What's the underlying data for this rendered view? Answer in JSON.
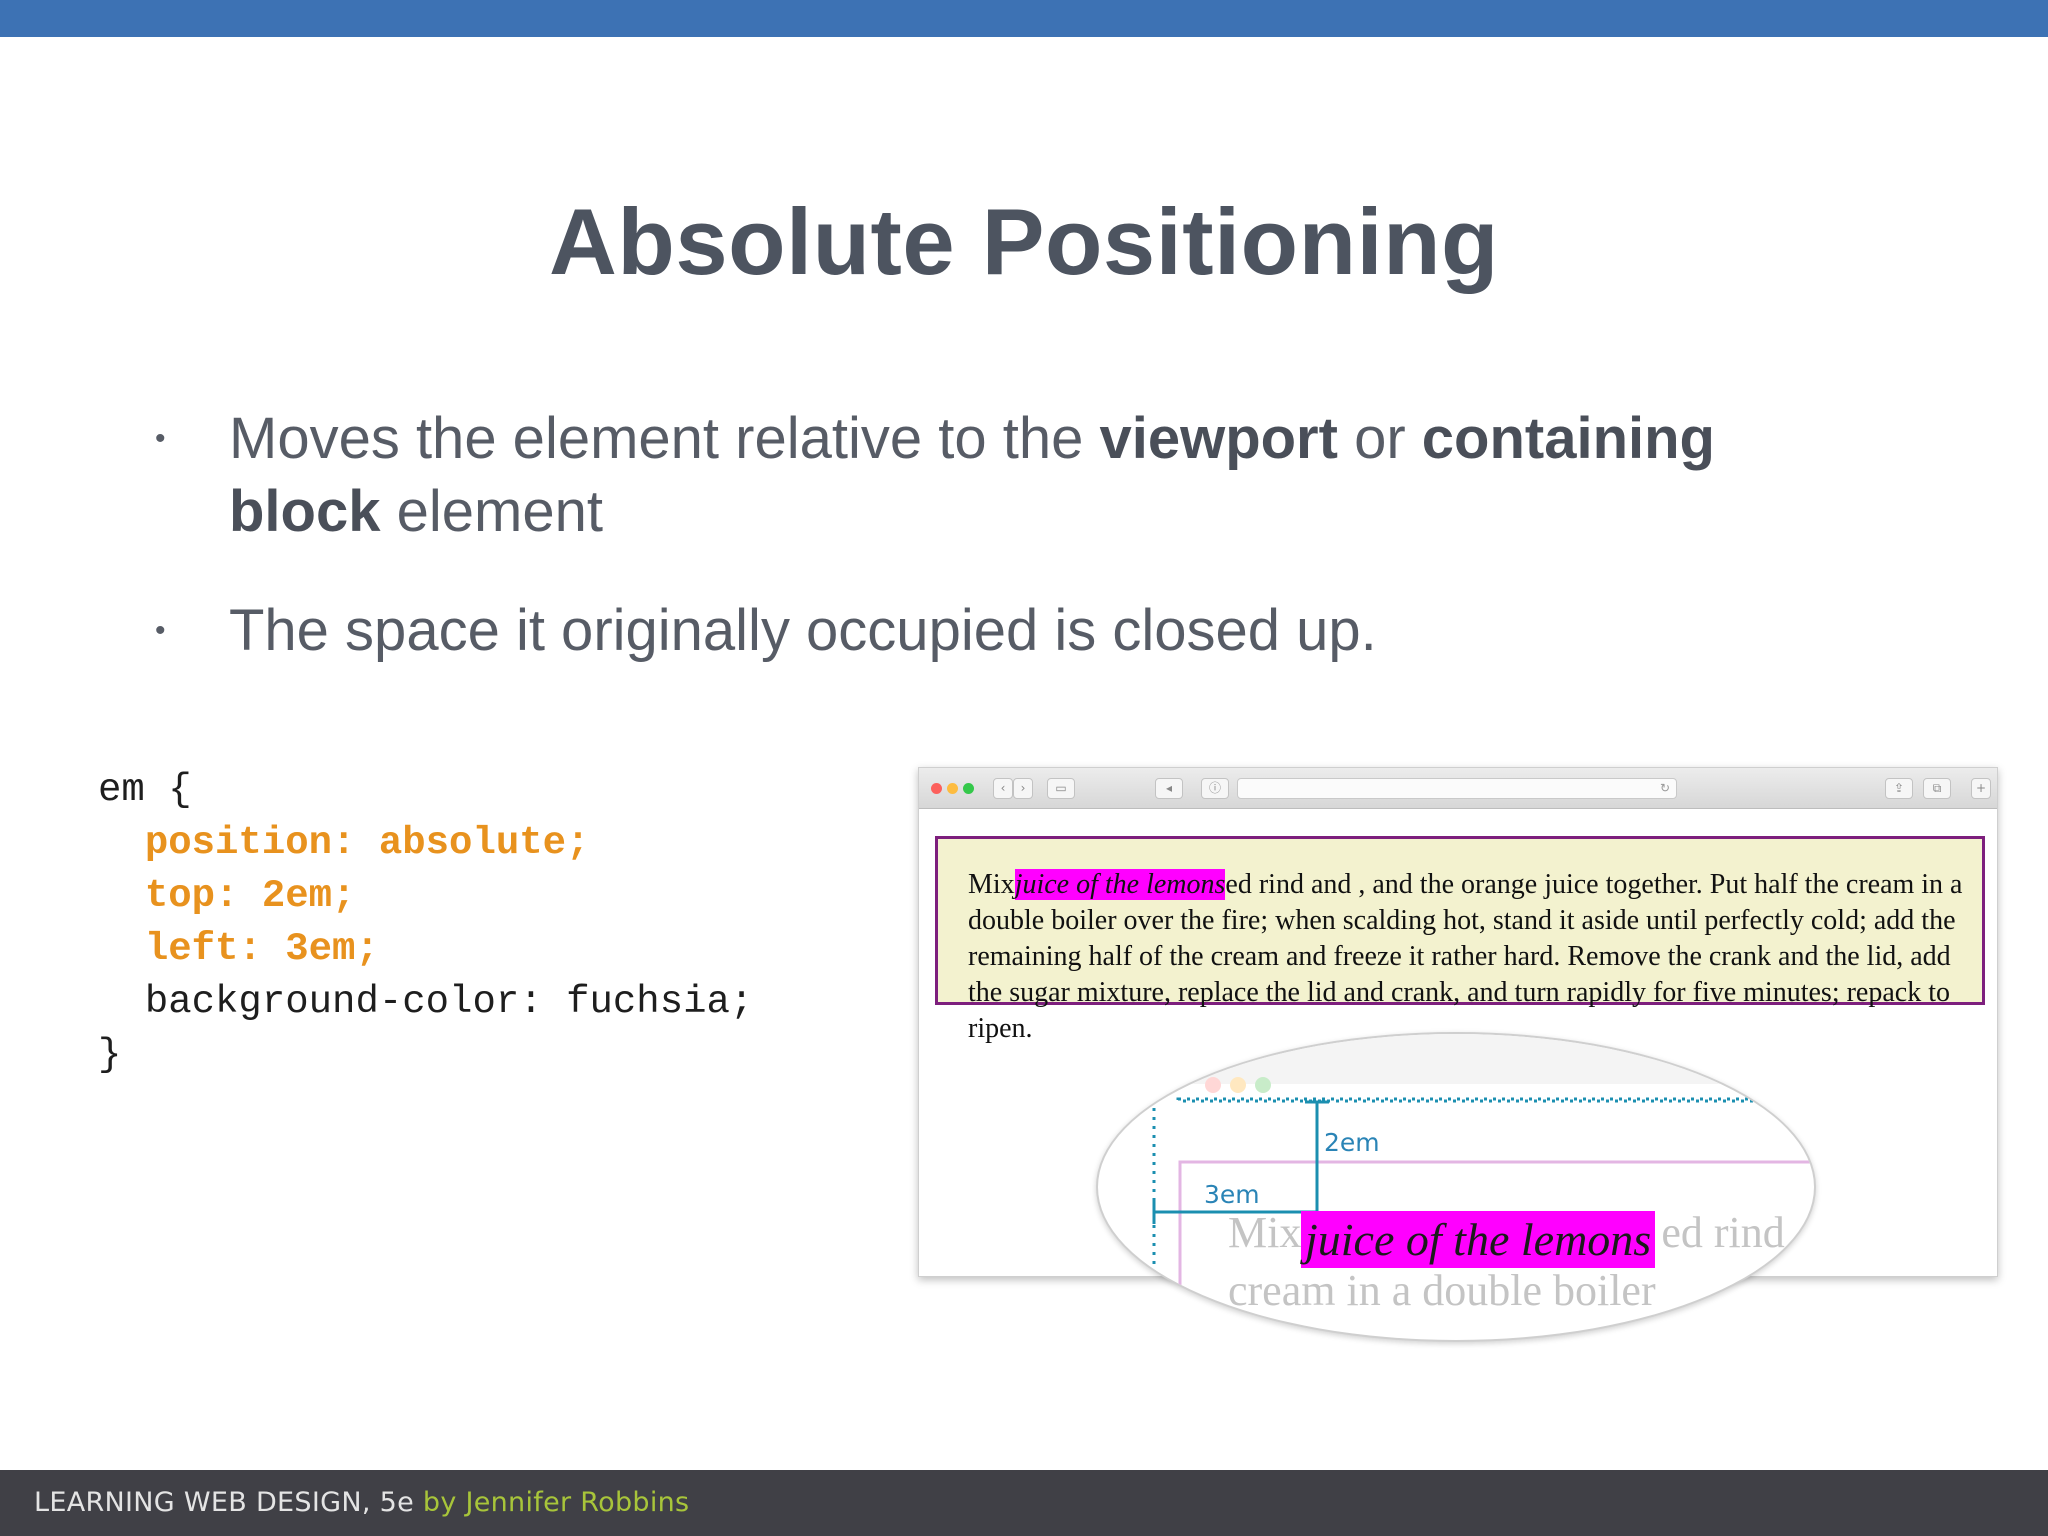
{
  "title": "Absolute Positioning",
  "bullets": [
    {
      "pre": "Moves the element relative to the ",
      "b1": "viewport",
      "mid": " or ",
      "b2": "containing block",
      "post": " element"
    },
    {
      "text": "The space it originally occupied is closed up."
    }
  ],
  "code": {
    "line1": "em {",
    "line2": "position: absolute;",
    "line3": "top: 2em;",
    "line4": "left: 3em;",
    "line5": "background-color: fuchsia;",
    "line6": "}"
  },
  "browser": {
    "para_start": "Mix",
    "para_em": "juice of the lemons",
    "para_rest": "ed rind and , and the orange juice together. Put half the cream in a double boiler over the fire; when scalding hot, stand it aside until perfectly cold; add the remaining half of the cream and freeze it rather hard. Remove the crank and the lid, add the sugar mixture, replace the lid and crank, and turn rapidly for five minutes; repack to ripen."
  },
  "lens": {
    "top_label": "2em",
    "left_label": "3em",
    "para_line1_start": "Mix",
    "para_line1_end": "ed rind",
    "para_line2": "cream in a double boiler",
    "em_text": "juice of the lemons"
  },
  "footer": {
    "book": "LEARNING WEB DESIGN, 5e",
    "author": "by Jennifer Robbins"
  },
  "colors": {
    "top_bar": "#3d72b4",
    "title": "#4d5460",
    "code_highlight": "#e8921e",
    "fuchsia": "#ff00ff",
    "para_bg": "#f3f2cf",
    "para_border": "#7d1f7d",
    "dimension_lines": "#2a84b6",
    "footer_bg": "#404046",
    "footer_author": "#a8c53a"
  }
}
